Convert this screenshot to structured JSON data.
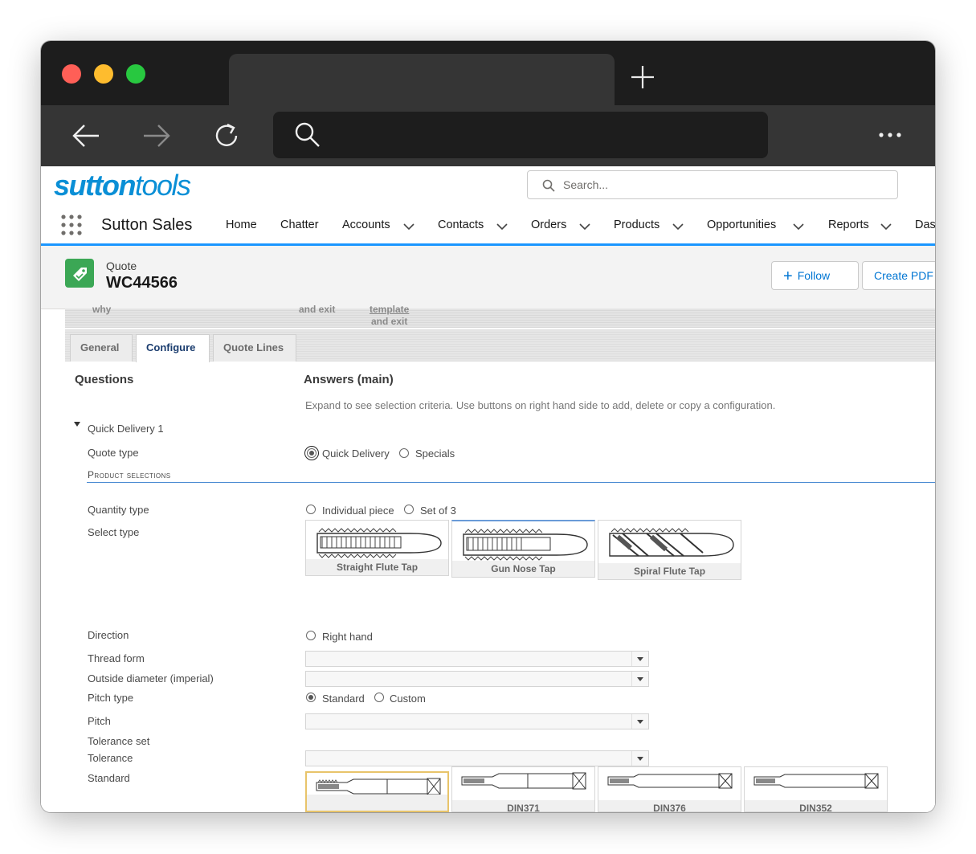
{
  "browser": {
    "controls": {
      "close_color": "#ff5f57",
      "min_color": "#febc2e",
      "max_color": "#28c840"
    },
    "icons": [
      "back-icon",
      "forward-icon",
      "reload-icon",
      "search-icon",
      "new-tab-icon",
      "more-icon"
    ]
  },
  "header": {
    "logo_bold": "sutton",
    "logo_light": "tools",
    "search_placeholder": "Search...",
    "app_name": "Sutton Sales",
    "nav": [
      {
        "label": "Home"
      },
      {
        "label": "Chatter"
      },
      {
        "label": "Accounts"
      },
      {
        "label": "Contacts"
      },
      {
        "label": "Orders"
      },
      {
        "label": "Products"
      },
      {
        "label": "Opportunities"
      },
      {
        "label": "Reports"
      },
      {
        "label": "Das"
      }
    ]
  },
  "record": {
    "type": "Quote",
    "name": "WC44566",
    "follow_label": "Follow",
    "create_pdf_label": "Create PDF"
  },
  "configurator": {
    "strip": {
      "t1": "why",
      "t2": "and exit",
      "t3": "template",
      "t4": "and exit"
    },
    "tabs": [
      {
        "label": "General"
      },
      {
        "label": "Configure"
      },
      {
        "label": "Quote Lines"
      }
    ],
    "questions_heading": "Questions",
    "answers_heading": "Answers (main)",
    "description": "Expand to see selection criteria. Use buttons on right hand side to add, delete or copy a configuration.",
    "group_label": "Quick Delivery 1",
    "quote_type": {
      "label": "Quote type",
      "options": [
        "Quick Delivery",
        "Specials"
      ],
      "selected": "Quick Delivery"
    },
    "section_title": "Product selections",
    "quantity_type": {
      "label": "Quantity type",
      "options": [
        "Individual piece",
        "Set of 3"
      ]
    },
    "select_type": {
      "label": "Select type",
      "options": [
        "Straight Flute Tap",
        "Gun Nose Tap",
        "Spiral Flute Tap"
      ]
    },
    "direction": {
      "label": "Direction",
      "option": "Right hand"
    },
    "thread_form": {
      "label": "Thread form"
    },
    "outside_diameter": {
      "label": "Outside diameter (imperial)"
    },
    "pitch_type": {
      "label": "Pitch type",
      "options": [
        "Standard",
        "Custom"
      ],
      "selected": "Standard"
    },
    "pitch": {
      "label": "Pitch"
    },
    "tolerance_set": {
      "label": "Tolerance set"
    },
    "tolerance": {
      "label": "Tolerance"
    },
    "standard": {
      "label": "Standard",
      "options": [
        "",
        "DIN371",
        "DIN376",
        "DIN352"
      ]
    }
  }
}
